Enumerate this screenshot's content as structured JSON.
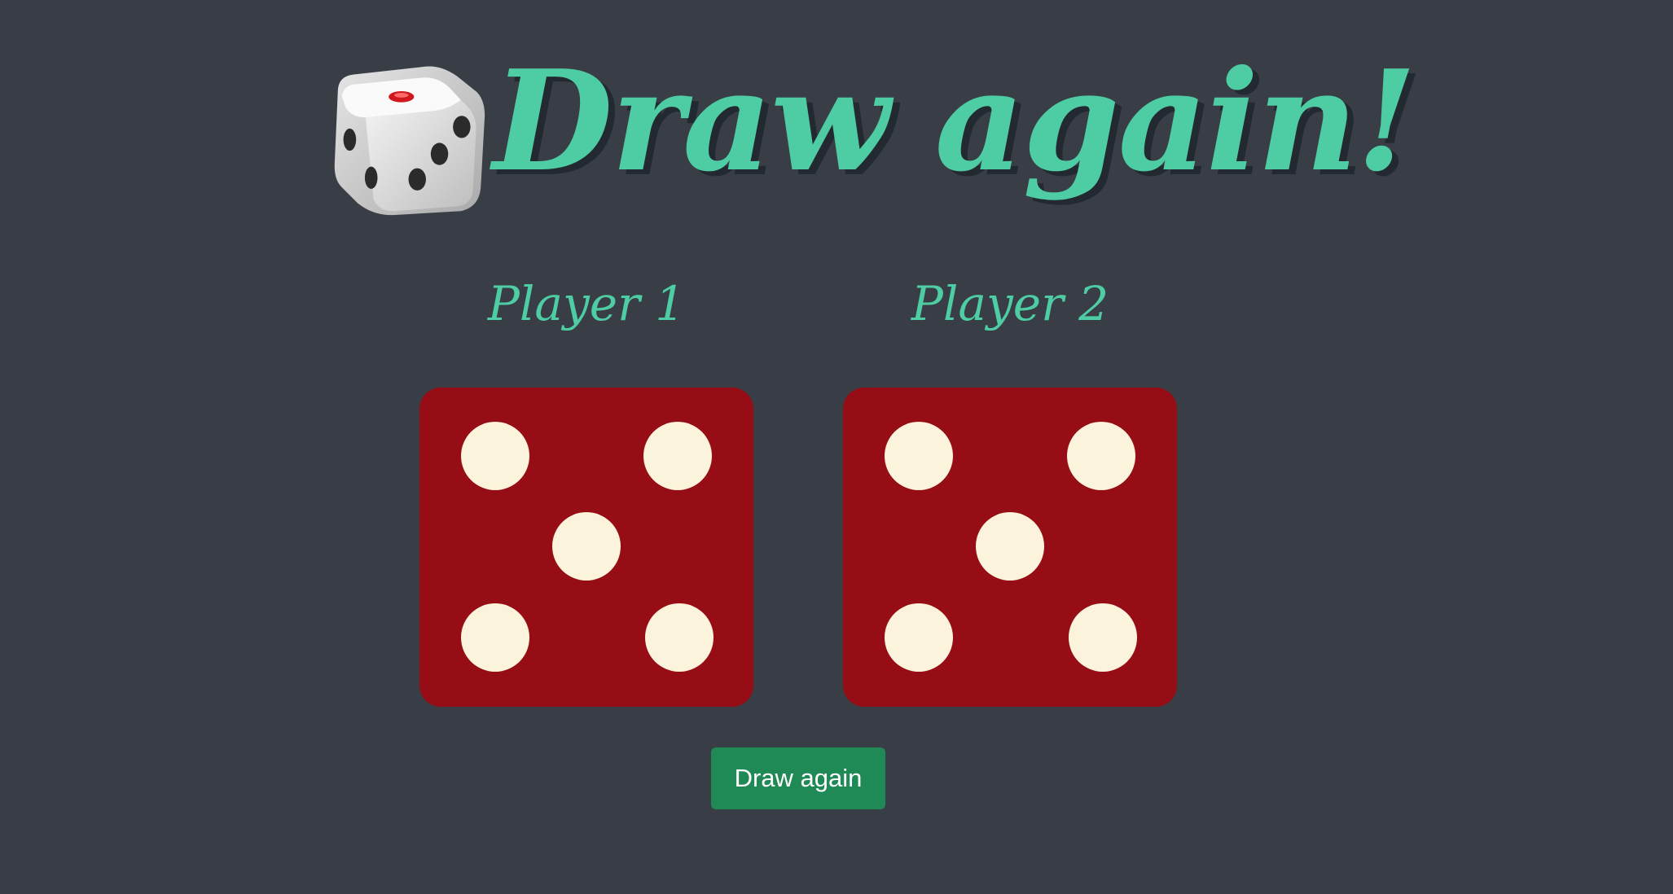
{
  "header": {
    "title": "Draw again!",
    "icon": "game-die-icon"
  },
  "players": [
    {
      "label": "Player 1",
      "die_value": 5
    },
    {
      "label": "Player 2",
      "die_value": 5
    }
  ],
  "actions": {
    "draw_label": "Draw again"
  },
  "colors": {
    "background": "#393e46",
    "accent": "#4ecca3",
    "die_face": "#970d15",
    "pip": "#fbf3dc",
    "button": "#1f8a55"
  }
}
